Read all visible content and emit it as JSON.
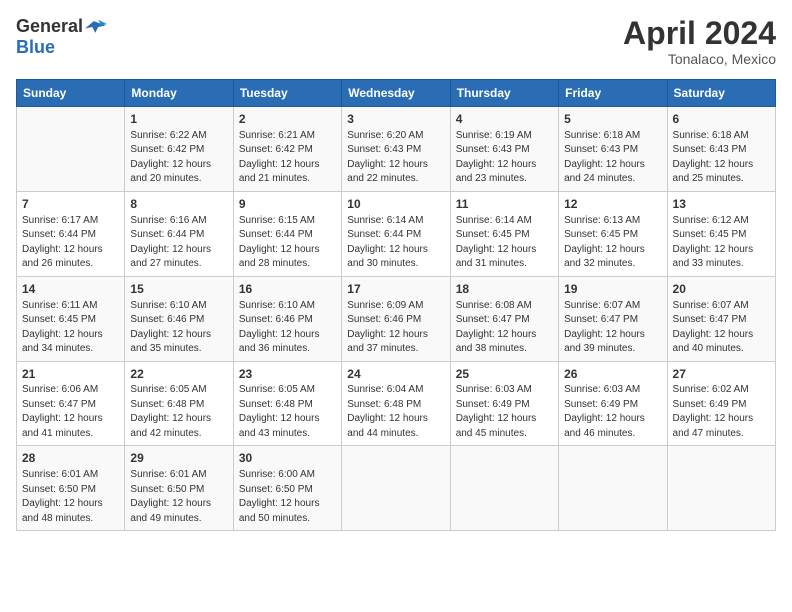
{
  "logo": {
    "text_general": "General",
    "text_blue": "Blue"
  },
  "title": "April 2024",
  "subtitle": "Tonalaco, Mexico",
  "days_header": [
    "Sunday",
    "Monday",
    "Tuesday",
    "Wednesday",
    "Thursday",
    "Friday",
    "Saturday"
  ],
  "weeks": [
    [
      {
        "num": "",
        "info": ""
      },
      {
        "num": "1",
        "info": "Sunrise: 6:22 AM\nSunset: 6:42 PM\nDaylight: 12 hours\nand 20 minutes."
      },
      {
        "num": "2",
        "info": "Sunrise: 6:21 AM\nSunset: 6:42 PM\nDaylight: 12 hours\nand 21 minutes."
      },
      {
        "num": "3",
        "info": "Sunrise: 6:20 AM\nSunset: 6:43 PM\nDaylight: 12 hours\nand 22 minutes."
      },
      {
        "num": "4",
        "info": "Sunrise: 6:19 AM\nSunset: 6:43 PM\nDaylight: 12 hours\nand 23 minutes."
      },
      {
        "num": "5",
        "info": "Sunrise: 6:18 AM\nSunset: 6:43 PM\nDaylight: 12 hours\nand 24 minutes."
      },
      {
        "num": "6",
        "info": "Sunrise: 6:18 AM\nSunset: 6:43 PM\nDaylight: 12 hours\nand 25 minutes."
      }
    ],
    [
      {
        "num": "7",
        "info": "Sunrise: 6:17 AM\nSunset: 6:44 PM\nDaylight: 12 hours\nand 26 minutes."
      },
      {
        "num": "8",
        "info": "Sunrise: 6:16 AM\nSunset: 6:44 PM\nDaylight: 12 hours\nand 27 minutes."
      },
      {
        "num": "9",
        "info": "Sunrise: 6:15 AM\nSunset: 6:44 PM\nDaylight: 12 hours\nand 28 minutes."
      },
      {
        "num": "10",
        "info": "Sunrise: 6:14 AM\nSunset: 6:44 PM\nDaylight: 12 hours\nand 30 minutes."
      },
      {
        "num": "11",
        "info": "Sunrise: 6:14 AM\nSunset: 6:45 PM\nDaylight: 12 hours\nand 31 minutes."
      },
      {
        "num": "12",
        "info": "Sunrise: 6:13 AM\nSunset: 6:45 PM\nDaylight: 12 hours\nand 32 minutes."
      },
      {
        "num": "13",
        "info": "Sunrise: 6:12 AM\nSunset: 6:45 PM\nDaylight: 12 hours\nand 33 minutes."
      }
    ],
    [
      {
        "num": "14",
        "info": "Sunrise: 6:11 AM\nSunset: 6:45 PM\nDaylight: 12 hours\nand 34 minutes."
      },
      {
        "num": "15",
        "info": "Sunrise: 6:10 AM\nSunset: 6:46 PM\nDaylight: 12 hours\nand 35 minutes."
      },
      {
        "num": "16",
        "info": "Sunrise: 6:10 AM\nSunset: 6:46 PM\nDaylight: 12 hours\nand 36 minutes."
      },
      {
        "num": "17",
        "info": "Sunrise: 6:09 AM\nSunset: 6:46 PM\nDaylight: 12 hours\nand 37 minutes."
      },
      {
        "num": "18",
        "info": "Sunrise: 6:08 AM\nSunset: 6:47 PM\nDaylight: 12 hours\nand 38 minutes."
      },
      {
        "num": "19",
        "info": "Sunrise: 6:07 AM\nSunset: 6:47 PM\nDaylight: 12 hours\nand 39 minutes."
      },
      {
        "num": "20",
        "info": "Sunrise: 6:07 AM\nSunset: 6:47 PM\nDaylight: 12 hours\nand 40 minutes."
      }
    ],
    [
      {
        "num": "21",
        "info": "Sunrise: 6:06 AM\nSunset: 6:47 PM\nDaylight: 12 hours\nand 41 minutes."
      },
      {
        "num": "22",
        "info": "Sunrise: 6:05 AM\nSunset: 6:48 PM\nDaylight: 12 hours\nand 42 minutes."
      },
      {
        "num": "23",
        "info": "Sunrise: 6:05 AM\nSunset: 6:48 PM\nDaylight: 12 hours\nand 43 minutes."
      },
      {
        "num": "24",
        "info": "Sunrise: 6:04 AM\nSunset: 6:48 PM\nDaylight: 12 hours\nand 44 minutes."
      },
      {
        "num": "25",
        "info": "Sunrise: 6:03 AM\nSunset: 6:49 PM\nDaylight: 12 hours\nand 45 minutes."
      },
      {
        "num": "26",
        "info": "Sunrise: 6:03 AM\nSunset: 6:49 PM\nDaylight: 12 hours\nand 46 minutes."
      },
      {
        "num": "27",
        "info": "Sunrise: 6:02 AM\nSunset: 6:49 PM\nDaylight: 12 hours\nand 47 minutes."
      }
    ],
    [
      {
        "num": "28",
        "info": "Sunrise: 6:01 AM\nSunset: 6:50 PM\nDaylight: 12 hours\nand 48 minutes."
      },
      {
        "num": "29",
        "info": "Sunrise: 6:01 AM\nSunset: 6:50 PM\nDaylight: 12 hours\nand 49 minutes."
      },
      {
        "num": "30",
        "info": "Sunrise: 6:00 AM\nSunset: 6:50 PM\nDaylight: 12 hours\nand 50 minutes."
      },
      {
        "num": "",
        "info": ""
      },
      {
        "num": "",
        "info": ""
      },
      {
        "num": "",
        "info": ""
      },
      {
        "num": "",
        "info": ""
      }
    ]
  ]
}
